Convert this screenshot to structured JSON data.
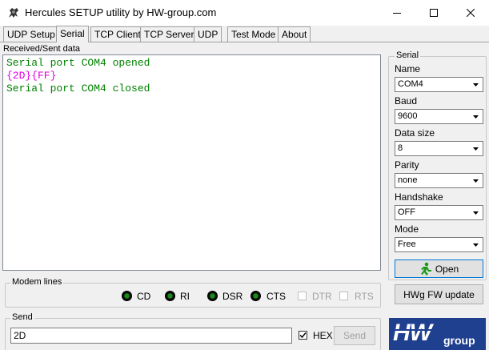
{
  "window": {
    "title": "Hercules SETUP utility by HW-group.com"
  },
  "tabs": [
    {
      "label": "UDP Setup"
    },
    {
      "label": "Serial",
      "active": true
    },
    {
      "label": "TCP Client"
    },
    {
      "label": "TCP Server"
    },
    {
      "label": "UDP"
    },
    {
      "label": "Test Mode"
    },
    {
      "label": "About"
    }
  ],
  "received": {
    "label": "Received/Sent data",
    "lines": [
      {
        "text": "Serial port COM4 opened",
        "color": "#008000"
      },
      {
        "text": "{2D}{FF}",
        "color": "#e000e0"
      },
      {
        "text": "Serial port COM4 closed",
        "color": "#008000"
      }
    ]
  },
  "serial": {
    "legend": "Serial",
    "name_label": "Name",
    "name_value": "COM4",
    "baud_label": "Baud",
    "baud_value": "9600",
    "datasize_label": "Data size",
    "datasize_value": "8",
    "parity_label": "Parity",
    "parity_value": "none",
    "handshake_label": "Handshake",
    "handshake_value": "OFF",
    "mode_label": "Mode",
    "mode_value": "Free",
    "open_label": "Open",
    "fwupdate_label": "HWg FW update"
  },
  "modem": {
    "legend": "Modem lines",
    "cd": "CD",
    "ri": "RI",
    "dsr": "DSR",
    "cts": "CTS",
    "dtr": "DTR",
    "rts": "RTS"
  },
  "send": {
    "legend": "Send",
    "input_value": "2D",
    "hex_label": "HEX",
    "send_label": "Send"
  },
  "logo": {
    "text_top": "HW",
    "text_bottom": "group"
  }
}
